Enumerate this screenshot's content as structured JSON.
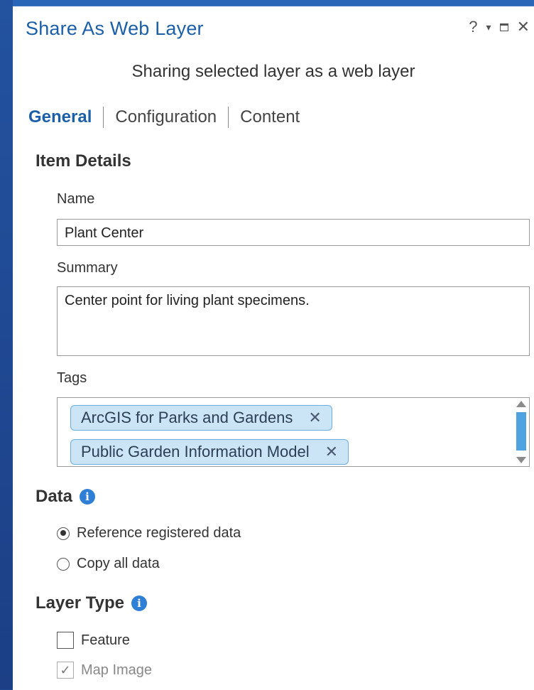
{
  "window": {
    "title": "Share As Web Layer",
    "controls": {
      "help": "?",
      "menu": "▾",
      "close": "✕"
    }
  },
  "subtitle": "Sharing selected layer as a web layer",
  "tabs": [
    {
      "label": "General",
      "active": true
    },
    {
      "label": "Configuration",
      "active": false
    },
    {
      "label": "Content",
      "active": false
    }
  ],
  "item_details": {
    "heading": "Item Details",
    "name_label": "Name",
    "name_value": "Plant Center",
    "summary_label": "Summary",
    "summary_value": "Center point for living plant specimens.",
    "tags_label": "Tags",
    "tags": [
      {
        "label": "ArcGIS for Parks and Gardens",
        "remove": "✕"
      },
      {
        "label": "Public Garden Information Model",
        "remove": "✕"
      }
    ]
  },
  "data_section": {
    "heading": "Data",
    "info": "i",
    "options": [
      {
        "label": "Reference registered data",
        "selected": true
      },
      {
        "label": "Copy all data",
        "selected": false
      }
    ]
  },
  "layer_type": {
    "heading": "Layer Type",
    "info": "i",
    "options": [
      {
        "label": "Feature",
        "checked": false,
        "disabled": false
      },
      {
        "label": "Map Image",
        "checked": true,
        "disabled": true,
        "check_glyph": "✓"
      }
    ]
  },
  "colors": {
    "accent": "#1b5fa8",
    "info_icon": "#2f7fd6",
    "tag_fill": "#cbe4f6",
    "tag_border": "#6aaee0",
    "scroll_thumb": "#4ea3e0",
    "backdrop": "#1f4a94"
  }
}
